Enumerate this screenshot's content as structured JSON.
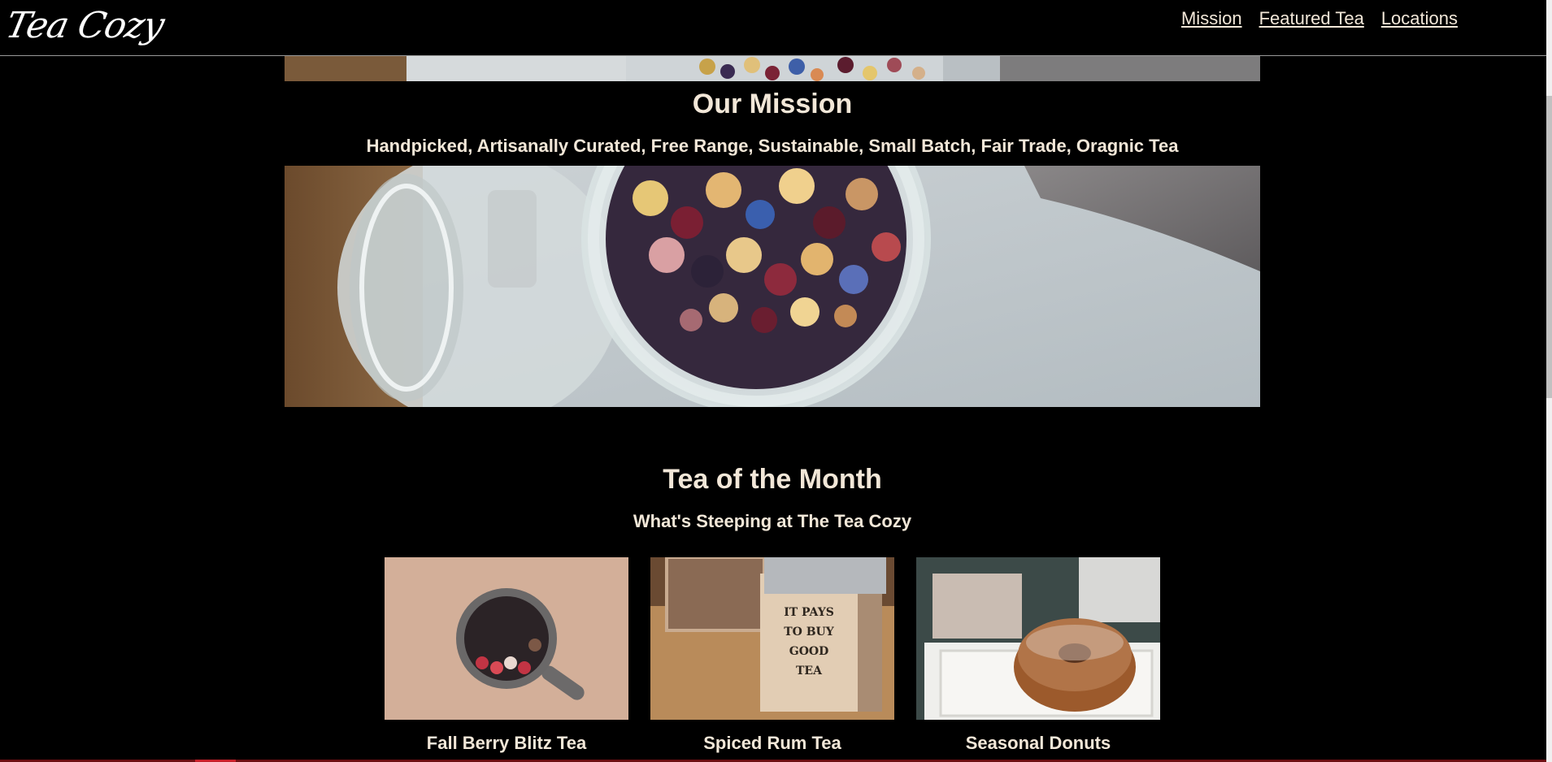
{
  "header": {
    "logo": "Tea Cozy",
    "nav": [
      {
        "label": "Mission"
      },
      {
        "label": "Featured Tea"
      },
      {
        "label": "Locations"
      }
    ]
  },
  "mission": {
    "title": "Our Mission",
    "subtitle": "Handpicked, Artisanally Curated, Free Range, Sustainable, Small Batch, Fair Trade, Oragnic Tea"
  },
  "tea_of_month": {
    "title": "Tea of the Month",
    "subtitle": "What's Steeping at The Tea Cozy",
    "items": [
      {
        "name": "Fall Berry Blitz Tea",
        "image": "berry-tea-mug-image"
      },
      {
        "name": "Spiced Rum Tea",
        "image": "tea-box-image",
        "sign_text": "IT PAYS TO BUY GOOD TEA"
      },
      {
        "name": "Seasonal Donuts",
        "image": "donut-image"
      }
    ]
  },
  "colors": {
    "background": "#000000",
    "text": "#f2e7d8",
    "accent": "#c8202a"
  }
}
